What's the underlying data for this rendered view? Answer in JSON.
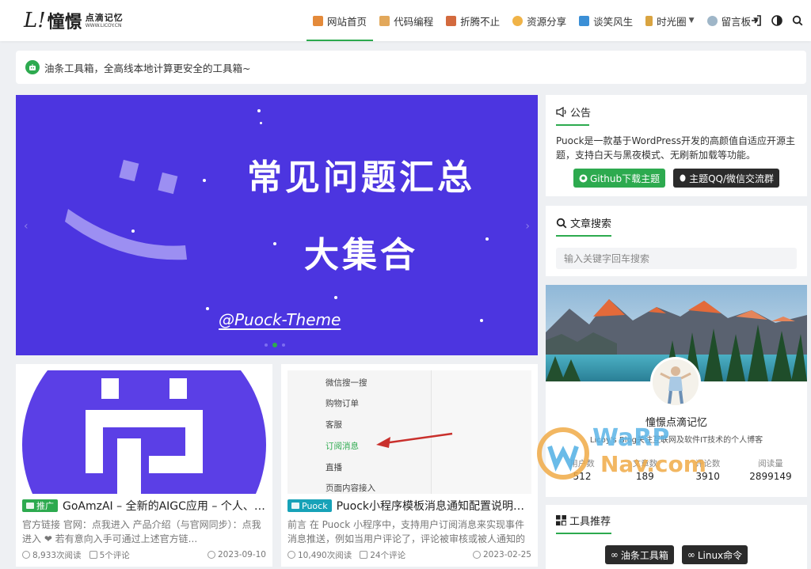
{
  "site": {
    "logo_mark": "L!",
    "logo_main": "憧憬",
    "logo_sub": "点滴记忆",
    "logo_url": "WWW.LICOY.CN"
  },
  "nav": {
    "items": [
      {
        "label": "网站首页",
        "icon": "home-icon",
        "color": "#e48a3a",
        "active": true,
        "dropdown": false
      },
      {
        "label": "代码编程",
        "icon": "code-icon",
        "color": "#e2a85b",
        "active": false,
        "dropdown": false
      },
      {
        "label": "折腾不止",
        "icon": "brick-icon",
        "color": "#d36a3e",
        "active": false,
        "dropdown": false
      },
      {
        "label": "资源分享",
        "icon": "smile-icon",
        "color": "#f0b347",
        "active": false,
        "dropdown": false
      },
      {
        "label": "谈笑风生",
        "icon": "book-icon",
        "color": "#3b8fd6",
        "active": false,
        "dropdown": false
      },
      {
        "label": "时光圈",
        "icon": "hourglass-icon",
        "color": "#d9a441",
        "active": false,
        "dropdown": true
      },
      {
        "label": "留言板",
        "icon": "speech-icon",
        "color": "#9fb6c8",
        "active": false,
        "dropdown": true
      }
    ]
  },
  "notice": {
    "text": "油条工具箱，全高线本地计算更安全的工具箱~"
  },
  "hero": {
    "title1": "常见问题汇总",
    "title2": "大集合",
    "credit": "@Puock-Theme"
  },
  "posts": [
    {
      "tag": "推广",
      "tag_color": "#2daa4f",
      "title": "GoAmzAI – 全新的AIGC应用 – 个人、团...",
      "excerpt": "官方链接 官网：点我进入 产品介绍（与官网同步）：点我进入 ❤ 若有意向入手可通过上述官方链...",
      "views": "8,933次阅读",
      "comments": "5个评论",
      "date": "2023-09-10"
    },
    {
      "tag": "Puock",
      "tag_color": "#17a2b8",
      "title": "Puock小程序模板消息通知配置说明及步...",
      "excerpt": "前言 在 Puock 小程序中，支持用户订阅消息来实现事件消息推送，例如当用户评论了，评论被审核或被人通知的时...",
      "views": "10,490次阅读",
      "comments": "24个评论",
      "date": "2023-02-25",
      "menu_items": [
        "微信搜一搜",
        "购物订单",
        "客服",
        "订阅消息",
        "直播",
        "页面内容接入"
      ]
    }
  ],
  "sidebar": {
    "announce": {
      "title": "公告",
      "text": "Puock是一款基于WordPress开发的高颜值自适应开源主题，支持白天与黑夜模式、无刷新加载等功能。",
      "btn_github": "Github下载主题",
      "btn_qq": "主题QQ/微信交流群"
    },
    "search": {
      "title": "文章搜索",
      "placeholder": "输入关键字回车搜索"
    },
    "profile": {
      "name": "憧憬点滴记忆",
      "desc": "Licoy's Blog关注互联网及软件IT技术的个人博客",
      "stats": [
        {
          "label": "用户数",
          "value": "512"
        },
        {
          "label": "文章数",
          "value": "189"
        },
        {
          "label": "评论数",
          "value": "3910"
        },
        {
          "label": "阅读量",
          "value": "2899149"
        }
      ]
    },
    "tools": {
      "title": "工具推荐",
      "items": [
        "油条工具箱",
        "Linux命令"
      ]
    }
  },
  "watermark": {
    "line1": "WaRP",
    "line2": "Nav.com"
  }
}
